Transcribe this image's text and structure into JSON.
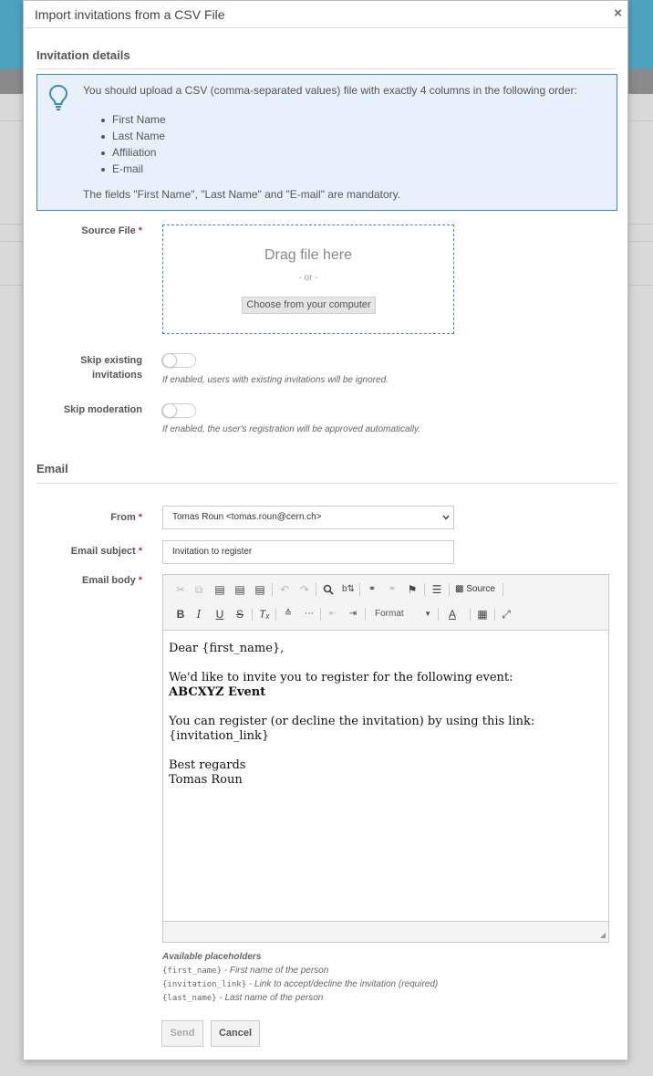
{
  "dialog": {
    "title": "Import invitations from a CSV File",
    "close_glyph": "×"
  },
  "invitation_details": {
    "section_title": "Invitation details",
    "info": {
      "icon": "lightbulb-icon",
      "text": "You should upload a CSV (comma-separated values) file with exactly 4 columns in the following order:",
      "columns": [
        "First Name",
        "Last Name",
        "Affiliation",
        "E-mail"
      ],
      "footer": "The fields \"First Name\", \"Last Name\" and \"E-mail\" are mandatory."
    },
    "source_file": {
      "label": "Source File",
      "required_mark": "*",
      "drop_title": "Drag file here",
      "drop_or": "- or -",
      "choose_button": "Choose from your computer"
    },
    "skip_existing": {
      "label_line1": "Skip existing",
      "label_line2": "invitations",
      "enabled": false,
      "hint": "If enabled, users with existing invitations will be ignored."
    },
    "skip_moderation": {
      "label": "Skip moderation",
      "enabled": false,
      "hint": "If enabled, the user's registration will be approved automatically."
    }
  },
  "email": {
    "section_title": "Email",
    "from": {
      "label": "From",
      "required_mark": "*",
      "value": "Tomas Roun <tomas.roun@cern.ch>"
    },
    "subject": {
      "label": "Email subject",
      "required_mark": "*",
      "value": "Invitation to register"
    },
    "body": {
      "label": "Email body",
      "required_mark": "*",
      "toolbar": {
        "source_label": "Source",
        "format_label": "Format"
      },
      "content": {
        "greeting": "Dear {first_name},",
        "line1": "We'd like to invite you to register for the following event:",
        "event": "ABCXYZ Event",
        "line2": "You can register (or decline the invitation) by using this link:",
        "link": "{invitation_link}",
        "signoff": "Best regards",
        "signature": "Tomas Roun"
      }
    },
    "placeholders": {
      "title": "Available placeholders",
      "items": [
        {
          "code": "{first_name}",
          "desc": " - First name of the person"
        },
        {
          "code": "{invitation_link}",
          "desc": " - Link to accept/decline the invitation (required)"
        },
        {
          "code": "{last_name}",
          "desc": " - Last name of the person"
        }
      ]
    }
  },
  "buttons": {
    "send": "Send",
    "cancel": "Cancel"
  }
}
